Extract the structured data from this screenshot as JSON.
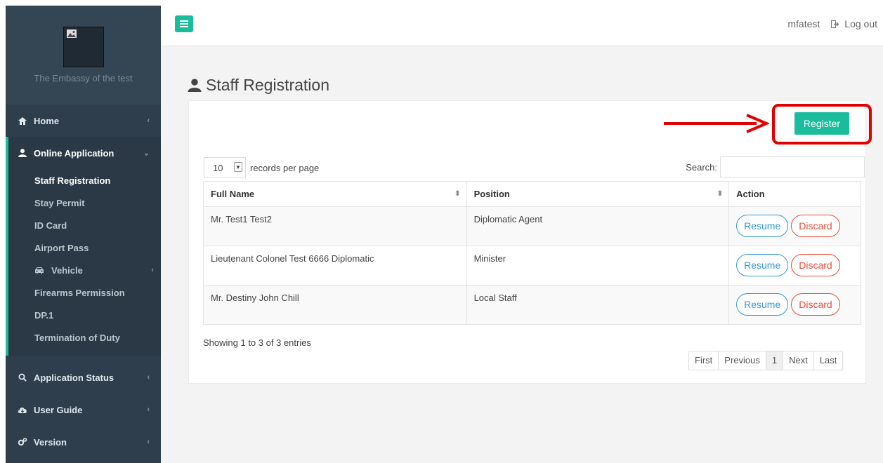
{
  "brand": {
    "name": "The Embassy of the test"
  },
  "sidebar": {
    "items": [
      {
        "label": "Home",
        "icon": "home-icon"
      },
      {
        "label": "Online Application",
        "icon": "user-icon"
      },
      {
        "label": "Application Status",
        "icon": "search-icon"
      },
      {
        "label": "User Guide",
        "icon": "cloud-icon"
      },
      {
        "label": "Version",
        "icon": "cogs-icon"
      }
    ],
    "submenu": [
      {
        "label": "Staff Registration"
      },
      {
        "label": "Stay Permit"
      },
      {
        "label": "ID Card"
      },
      {
        "label": "Airport Pass"
      },
      {
        "label": "Vehicle",
        "icon": "car-icon"
      },
      {
        "label": "Firearms Permission"
      },
      {
        "label": "DP.1"
      },
      {
        "label": "Termination of Duty"
      }
    ]
  },
  "topbar": {
    "username": "mfatest",
    "logout_label": "Log out"
  },
  "page": {
    "title": "Staff Registration"
  },
  "toolbar": {
    "register_label": "Register"
  },
  "table_controls": {
    "page_length": "10",
    "length_label": "records per page",
    "search_label": "Search:"
  },
  "table": {
    "headers": [
      "Full Name",
      "Position",
      "Action"
    ],
    "rows": [
      {
        "name": "Mr. Test1 Test2",
        "position": "Diplomatic Agent"
      },
      {
        "name": "Lieutenant Colonel Test 6666 Diplomatic",
        "position": "Minister"
      },
      {
        "name": "Mr. Destiny John Chill",
        "position": "Local Staff"
      }
    ],
    "resume_label": "Resume",
    "discard_label": "Discard"
  },
  "footer": {
    "info": "Showing 1 to 3 of 3 entries",
    "pager": [
      "First",
      "Previous",
      "1",
      "Next",
      "Last"
    ]
  },
  "colors": {
    "accent": "#1abc9c",
    "sidebar": "#2f3e4c",
    "highlight": "#e00000",
    "resume": "#3498db",
    "discard": "#e74c3c"
  }
}
